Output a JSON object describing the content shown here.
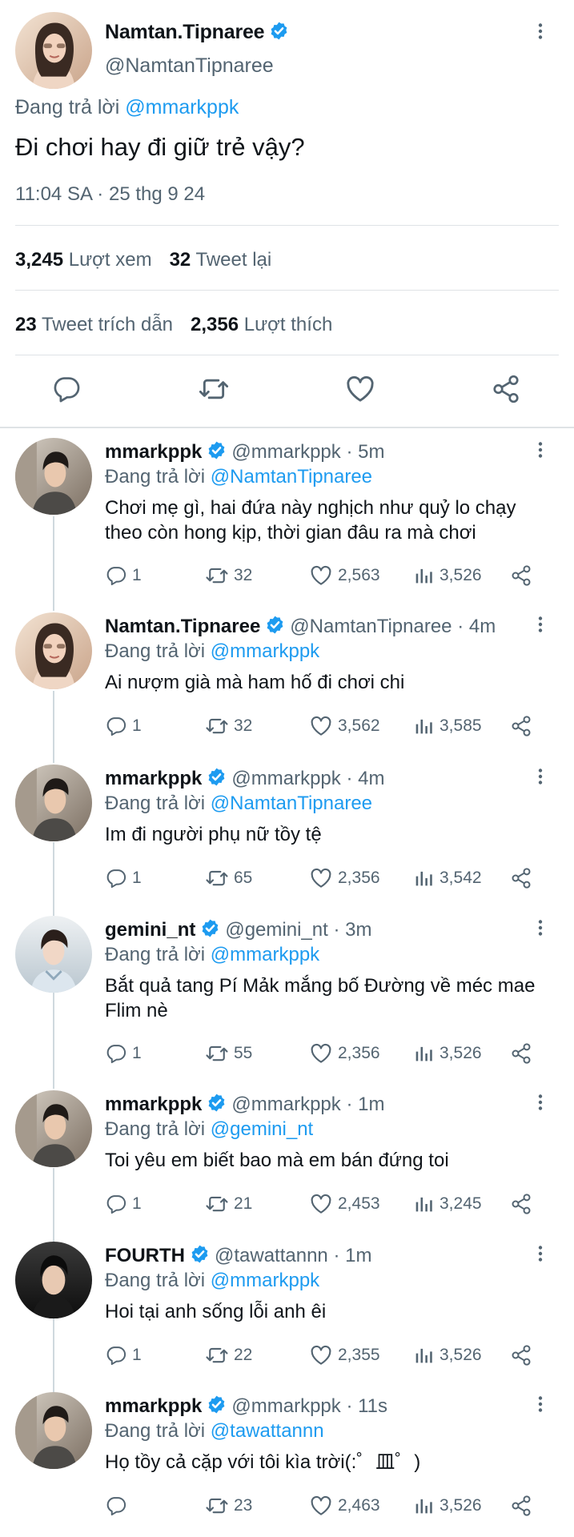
{
  "main_tweet": {
    "display_name": "Namtan.Tipnaree",
    "handle": "@NamtanTipnaree",
    "reply_prefix": "Đang trả lời",
    "reply_to": "@mmarkppk",
    "text": "Đi chơi hay đi giữ trẻ vậy?",
    "time": "11:04 SA · 25 thg 9 24",
    "views": "3,245",
    "views_label": "Lượt xem",
    "retweets": "32",
    "retweets_label": "Tweet lại",
    "quotes": "23",
    "quotes_label": "Tweet trích dẫn",
    "likes": "2,356",
    "likes_label": "Lượt thích"
  },
  "replies": [
    {
      "display_name": "mmarkppk",
      "handle": "@mmarkppk · 5m",
      "reply_prefix": "Đang trả lời",
      "reply_to": "@NamtanTipnaree",
      "text": "Chơi mẹ gì, hai đứa này nghịch như quỷ lo chạy theo còn hong kịp, thời gian đâu ra mà chơi",
      "replies": "1",
      "retweets": "32",
      "likes": "2,563",
      "views": "3,526"
    },
    {
      "display_name": "Namtan.Tipnaree",
      "handle": "@NamtanTipnaree · 4m",
      "reply_prefix": "Đang trả lời",
      "reply_to": "@mmarkppk",
      "text": "Ai nượm già mà ham hố đi chơi chi",
      "replies": "1",
      "retweets": "32",
      "likes": "3,562",
      "views": "3,585"
    },
    {
      "display_name": "mmarkppk",
      "handle": "@mmarkppk · 4m",
      "reply_prefix": "Đang trả lời",
      "reply_to": "@NamtanTipnaree",
      "text": "Im đi người phụ nữ tồy tệ",
      "replies": "1",
      "retweets": "65",
      "likes": "2,356",
      "views": "3,542"
    },
    {
      "display_name": "gemini_nt",
      "handle": "@gemini_nt · 3m",
      "reply_prefix": "Đang trả lời",
      "reply_to": "@mmarkppk",
      "text": "Bắt quả tang Pí Mảk mắng bố Đường về méc mae Flim nè",
      "replies": "1",
      "retweets": "55",
      "likes": "2,356",
      "views": "3,526"
    },
    {
      "display_name": "mmarkppk",
      "handle": "@mmarkppk · 1m",
      "reply_prefix": "Đang trả lời",
      "reply_to": "@gemini_nt",
      "text": "Toi yêu em biết bao mà em bán đứng toi",
      "replies": "1",
      "retweets": "21",
      "likes": "2,453",
      "views": "3,245"
    },
    {
      "display_name": "FOURTH",
      "handle": "@tawattannn · 1m",
      "reply_prefix": "Đang trả lời",
      "reply_to": "@mmarkppk",
      "text": "Hoi tại anh sống lỗi anh êi",
      "replies": "1",
      "retweets": "22",
      "likes": "2,355",
      "views": "3,526"
    },
    {
      "display_name": "mmarkppk",
      "handle": "@mmarkppk · 11s",
      "reply_prefix": "Đang trả lời",
      "reply_to": "@tawattannn",
      "text": "Họ tồy cả cặp với tôi kìa trời(:゜皿゜)",
      "replies": "",
      "retweets": "23",
      "likes": "2,463",
      "views": "3,526"
    }
  ],
  "colors": {
    "accent": "#1d9bf0",
    "text": "#0f1419",
    "muted": "#536471",
    "divider": "#dfe3e6"
  },
  "icons": [
    "verified-badge-icon",
    "more-options-icon",
    "reply-icon",
    "retweet-icon",
    "like-icon",
    "share-icon",
    "views-icon"
  ]
}
